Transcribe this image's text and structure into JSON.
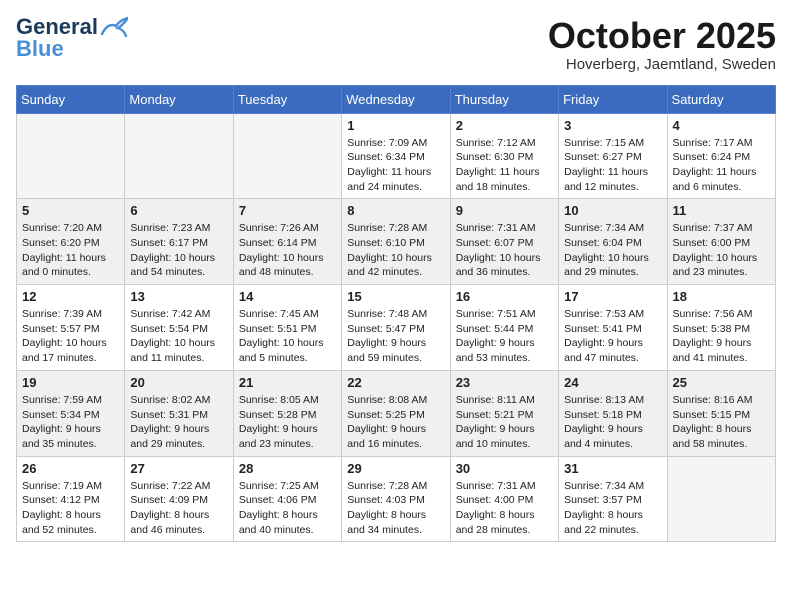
{
  "header": {
    "logo_general": "General",
    "logo_blue": "Blue",
    "month_title": "October 2025",
    "location": "Hoverberg, Jaemtland, Sweden"
  },
  "days_of_week": [
    "Sunday",
    "Monday",
    "Tuesday",
    "Wednesday",
    "Thursday",
    "Friday",
    "Saturday"
  ],
  "weeks": [
    [
      {
        "day": "",
        "info": ""
      },
      {
        "day": "",
        "info": ""
      },
      {
        "day": "",
        "info": ""
      },
      {
        "day": "1",
        "info": "Sunrise: 7:09 AM\nSunset: 6:34 PM\nDaylight: 11 hours\nand 24 minutes."
      },
      {
        "day": "2",
        "info": "Sunrise: 7:12 AM\nSunset: 6:30 PM\nDaylight: 11 hours\nand 18 minutes."
      },
      {
        "day": "3",
        "info": "Sunrise: 7:15 AM\nSunset: 6:27 PM\nDaylight: 11 hours\nand 12 minutes."
      },
      {
        "day": "4",
        "info": "Sunrise: 7:17 AM\nSunset: 6:24 PM\nDaylight: 11 hours\nand 6 minutes."
      }
    ],
    [
      {
        "day": "5",
        "info": "Sunrise: 7:20 AM\nSunset: 6:20 PM\nDaylight: 11 hours\nand 0 minutes."
      },
      {
        "day": "6",
        "info": "Sunrise: 7:23 AM\nSunset: 6:17 PM\nDaylight: 10 hours\nand 54 minutes."
      },
      {
        "day": "7",
        "info": "Sunrise: 7:26 AM\nSunset: 6:14 PM\nDaylight: 10 hours\nand 48 minutes."
      },
      {
        "day": "8",
        "info": "Sunrise: 7:28 AM\nSunset: 6:10 PM\nDaylight: 10 hours\nand 42 minutes."
      },
      {
        "day": "9",
        "info": "Sunrise: 7:31 AM\nSunset: 6:07 PM\nDaylight: 10 hours\nand 36 minutes."
      },
      {
        "day": "10",
        "info": "Sunrise: 7:34 AM\nSunset: 6:04 PM\nDaylight: 10 hours\nand 29 minutes."
      },
      {
        "day": "11",
        "info": "Sunrise: 7:37 AM\nSunset: 6:00 PM\nDaylight: 10 hours\nand 23 minutes."
      }
    ],
    [
      {
        "day": "12",
        "info": "Sunrise: 7:39 AM\nSunset: 5:57 PM\nDaylight: 10 hours\nand 17 minutes."
      },
      {
        "day": "13",
        "info": "Sunrise: 7:42 AM\nSunset: 5:54 PM\nDaylight: 10 hours\nand 11 minutes."
      },
      {
        "day": "14",
        "info": "Sunrise: 7:45 AM\nSunset: 5:51 PM\nDaylight: 10 hours\nand 5 minutes."
      },
      {
        "day": "15",
        "info": "Sunrise: 7:48 AM\nSunset: 5:47 PM\nDaylight: 9 hours\nand 59 minutes."
      },
      {
        "day": "16",
        "info": "Sunrise: 7:51 AM\nSunset: 5:44 PM\nDaylight: 9 hours\nand 53 minutes."
      },
      {
        "day": "17",
        "info": "Sunrise: 7:53 AM\nSunset: 5:41 PM\nDaylight: 9 hours\nand 47 minutes."
      },
      {
        "day": "18",
        "info": "Sunrise: 7:56 AM\nSunset: 5:38 PM\nDaylight: 9 hours\nand 41 minutes."
      }
    ],
    [
      {
        "day": "19",
        "info": "Sunrise: 7:59 AM\nSunset: 5:34 PM\nDaylight: 9 hours\nand 35 minutes."
      },
      {
        "day": "20",
        "info": "Sunrise: 8:02 AM\nSunset: 5:31 PM\nDaylight: 9 hours\nand 29 minutes."
      },
      {
        "day": "21",
        "info": "Sunrise: 8:05 AM\nSunset: 5:28 PM\nDaylight: 9 hours\nand 23 minutes."
      },
      {
        "day": "22",
        "info": "Sunrise: 8:08 AM\nSunset: 5:25 PM\nDaylight: 9 hours\nand 16 minutes."
      },
      {
        "day": "23",
        "info": "Sunrise: 8:11 AM\nSunset: 5:21 PM\nDaylight: 9 hours\nand 10 minutes."
      },
      {
        "day": "24",
        "info": "Sunrise: 8:13 AM\nSunset: 5:18 PM\nDaylight: 9 hours\nand 4 minutes."
      },
      {
        "day": "25",
        "info": "Sunrise: 8:16 AM\nSunset: 5:15 PM\nDaylight: 8 hours\nand 58 minutes."
      }
    ],
    [
      {
        "day": "26",
        "info": "Sunrise: 7:19 AM\nSunset: 4:12 PM\nDaylight: 8 hours\nand 52 minutes."
      },
      {
        "day": "27",
        "info": "Sunrise: 7:22 AM\nSunset: 4:09 PM\nDaylight: 8 hours\nand 46 minutes."
      },
      {
        "day": "28",
        "info": "Sunrise: 7:25 AM\nSunset: 4:06 PM\nDaylight: 8 hours\nand 40 minutes."
      },
      {
        "day": "29",
        "info": "Sunrise: 7:28 AM\nSunset: 4:03 PM\nDaylight: 8 hours\nand 34 minutes."
      },
      {
        "day": "30",
        "info": "Sunrise: 7:31 AM\nSunset: 4:00 PM\nDaylight: 8 hours\nand 28 minutes."
      },
      {
        "day": "31",
        "info": "Sunrise: 7:34 AM\nSunset: 3:57 PM\nDaylight: 8 hours\nand 22 minutes."
      },
      {
        "day": "",
        "info": ""
      }
    ]
  ]
}
